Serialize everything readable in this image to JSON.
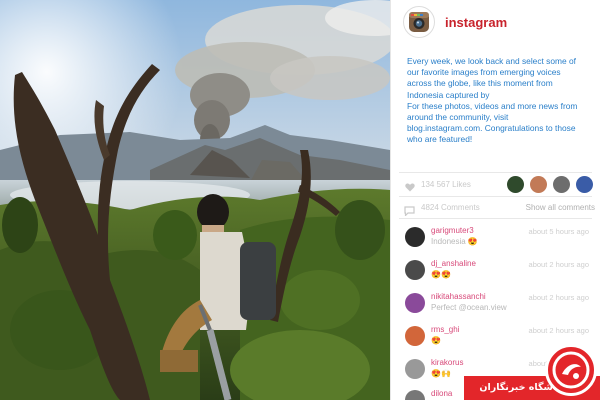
{
  "header": {
    "username": "instagram",
    "avatar_icon": "instagram-camera-icon"
  },
  "caption": {
    "paragraph1": "Every week, we look back and select some of our favorite images from emerging voices across the globe, like this moment from Indonesia captured by",
    "paragraph2": "For these photos, videos and more news from around the community, visit blog.instagram.com. Congratulations to those who are featured!"
  },
  "engagement": {
    "likes_text": "134 567 Likes",
    "comments_text": "4824 Comments",
    "show_all": "Show all comments",
    "heart_icon": "heart-icon",
    "comment_icon": "comment-bubble-icon",
    "liker_colors": [
      "#2f4a2c",
      "#c27a57",
      "#6d6d6d",
      "#3a5ca7"
    ]
  },
  "comments": [
    {
      "user": "garigmuter3",
      "text": "Indonesia 😍",
      "time": "about 5 hours ago",
      "avatar_color": "#2b2b2b"
    },
    {
      "user": "dj_anshaline",
      "text": "😍😍",
      "time": "about 2 hours ago",
      "avatar_color": "#4a4a4a"
    },
    {
      "user": "nikitahassanchi",
      "text": "Perfect @ocean.view",
      "time": "about 2 hours ago",
      "avatar_color": "#8a4a9a"
    },
    {
      "user": "rms_ghi",
      "text": "😍",
      "time": "about 2 hours ago",
      "avatar_color": "#d2663a"
    },
    {
      "user": "kirakorus",
      "text": "😍🙌",
      "time": "about 2 hours ago",
      "avatar_color": "#999999"
    },
    {
      "user": "dilona",
      "text": "",
      "time": "",
      "avatar_color": "#777777"
    }
  ],
  "watermark": {
    "text": "باشگاه خبرنگاران",
    "color": "#e3262a"
  }
}
